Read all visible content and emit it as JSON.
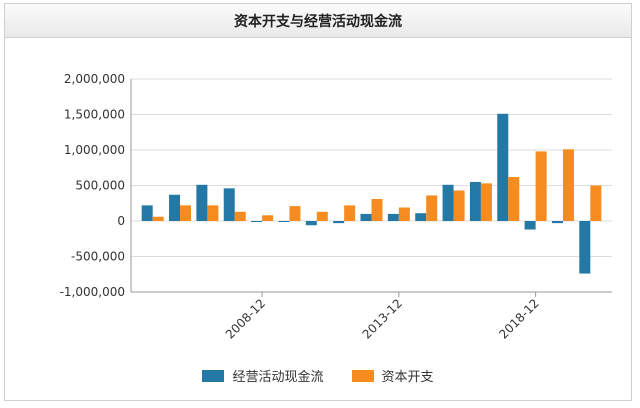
{
  "chart_data": {
    "type": "bar",
    "title": "资本开支与经营活动现金流",
    "x_tick_labels": [
      "2008-12",
      "2013-12",
      "2018-12"
    ],
    "x_tick_indices": [
      4.5,
      9.5,
      14.5
    ],
    "ylim": [
      -1000000,
      2000000
    ],
    "yticks": [
      -1000000,
      -500000,
      0,
      500000,
      1000000,
      1500000,
      2000000
    ],
    "ytick_labels": [
      "-1,000,000",
      "-500,000",
      "0",
      "500,000",
      "1,000,000",
      "1,500,000",
      "2,000,000"
    ],
    "grid": true,
    "legend": "bottom",
    "series": [
      {
        "name": "经营活动现金流",
        "color": "#2478a5",
        "values": [
          220000,
          370000,
          510000,
          460000,
          -10000,
          -10000,
          -60000,
          -30000,
          100000,
          100000,
          110000,
          510000,
          550000,
          1510000,
          -120000,
          -30000,
          -740000
        ]
      },
      {
        "name": "资本开支",
        "color": "#f68c1f",
        "values": [
          60000,
          220000,
          220000,
          130000,
          80000,
          210000,
          130000,
          220000,
          310000,
          190000,
          360000,
          430000,
          530000,
          620000,
          980000,
          1010000,
          500000
        ]
      }
    ]
  }
}
